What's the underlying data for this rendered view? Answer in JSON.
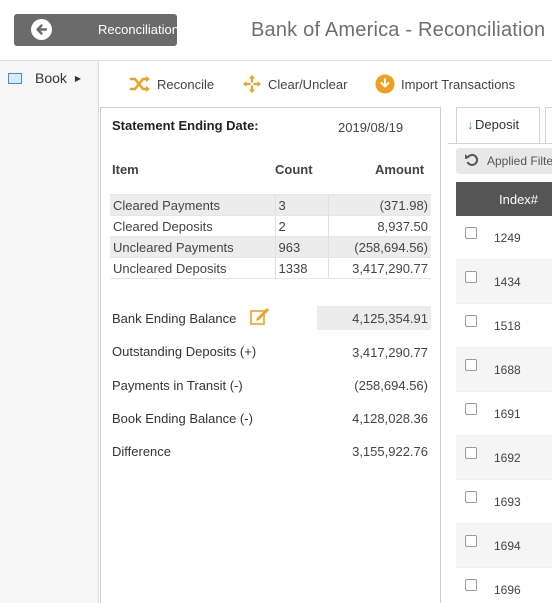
{
  "header": {
    "back_label": "Reconciliation",
    "title": "Bank of America - Reconciliation >"
  },
  "sidebar": {
    "items": [
      {
        "label": "Book",
        "icon": "calendar-icon"
      }
    ]
  },
  "toolbar": {
    "reconcile": "Reconcile",
    "clear_unclear": "Clear/Unclear",
    "import": "Import Transactions"
  },
  "summary": {
    "statement_label": "Statement Ending Date:",
    "statement_date": "2019/08/19",
    "columns": [
      "Item",
      "Count",
      "Amount"
    ],
    "rows": [
      {
        "item": "Cleared Payments",
        "count": "3",
        "amount": "(371.98)"
      },
      {
        "item": "Cleared Deposits",
        "count": "2",
        "amount": "8,937.50"
      },
      {
        "item": "Uncleared Payments",
        "count": "963",
        "amount": "(258,694.56)"
      },
      {
        "item": "Uncleared Deposits",
        "count": "1338",
        "amount": "3,417,290.77"
      }
    ],
    "balances": [
      {
        "label": "Bank Ending Balance",
        "value": "4,125,354.91"
      },
      {
        "label": "Outstanding Deposits (+)",
        "value": "3,417,290.77"
      },
      {
        "label": "Payments in Transit (-)",
        "value": "(258,694.56)"
      },
      {
        "label": "Book Ending Balance (-)",
        "value": "4,128,028.36"
      },
      {
        "label": "Difference",
        "value": "3,155,922.76"
      }
    ]
  },
  "right": {
    "tab_label": "Deposit",
    "filter_label": "Applied Filte",
    "grid_header": "Index#",
    "rows": [
      "1249",
      "1434",
      "1518",
      "1688",
      "1691",
      "1692",
      "1693",
      "1694",
      "1696"
    ]
  },
  "colors": {
    "accent": "#3a8ee6",
    "header_bg": "#6b6b6b",
    "grid_header": "#555555",
    "edit_icon": "#f0a020"
  }
}
